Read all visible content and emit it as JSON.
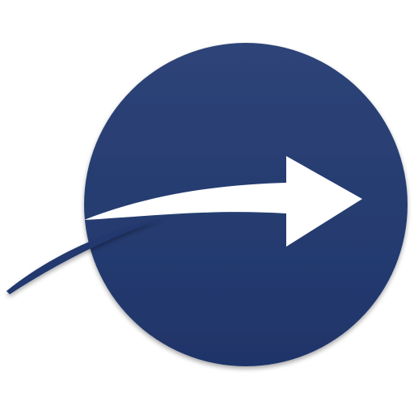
{
  "icon": {
    "name": "arrow-circle-logo",
    "background_color": "#ffffff",
    "circle_color_top": "#2e4478",
    "circle_color_bottom": "#1f356a",
    "arrow_color": "#ffffff",
    "swoosh_color": "#22386e"
  }
}
